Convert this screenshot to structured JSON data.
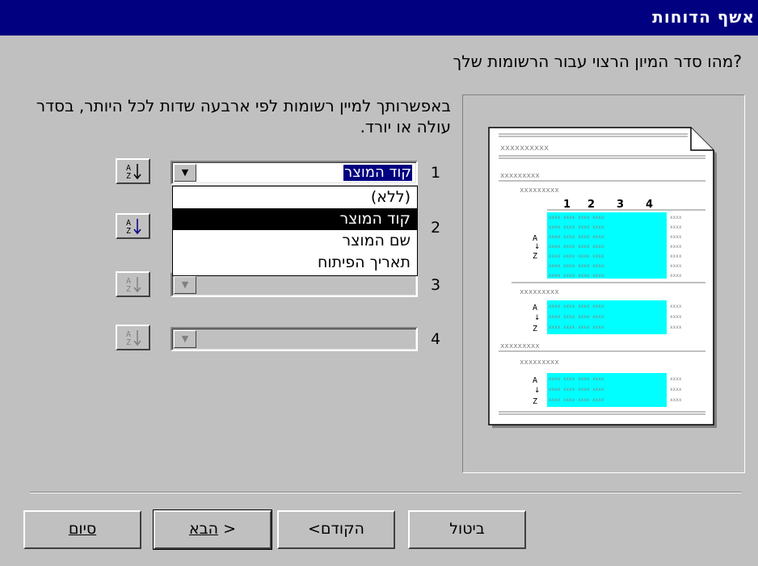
{
  "window": {
    "title": "אשף הדוחות"
  },
  "question": "מהו סדר המיון הרצוי עבור הרשומות שלך?",
  "instruction": "באפשרותך למיין רשומות לפי ארבעה שדות לכל היותר, בסדר עולה או יורד.",
  "sort_rows": [
    {
      "number": "1",
      "value": "קוד המוצר",
      "enabled": true
    },
    {
      "number": "2",
      "value": "",
      "enabled": true
    },
    {
      "number": "3",
      "value": "",
      "enabled": false
    },
    {
      "number": "4",
      "value": "",
      "enabled": false
    }
  ],
  "dropdown": {
    "options": [
      "(ללא)",
      "קוד המוצר",
      "שם המוצר",
      "תאריך הפיתוח"
    ],
    "selected_index": 1
  },
  "preview": {
    "header_text": "xxxxxxxxxx",
    "group_text": "xxxxxxxxx",
    "column_numbers": [
      "1",
      "2",
      "3",
      "4"
    ],
    "cell_text": "xxxx",
    "sort_letters": {
      "top": "A",
      "bottom": "Z"
    },
    "highlight_color": "#00ffff"
  },
  "buttons": {
    "cancel": "ביטול",
    "back": "<הקודם",
    "next_prefix": "",
    "next_label": "הבא",
    "next_suffix": " >",
    "finish": "סיום"
  },
  "icons": {
    "sort": "sort-ascending-icon",
    "dropdown": "chevron-down-icon"
  }
}
